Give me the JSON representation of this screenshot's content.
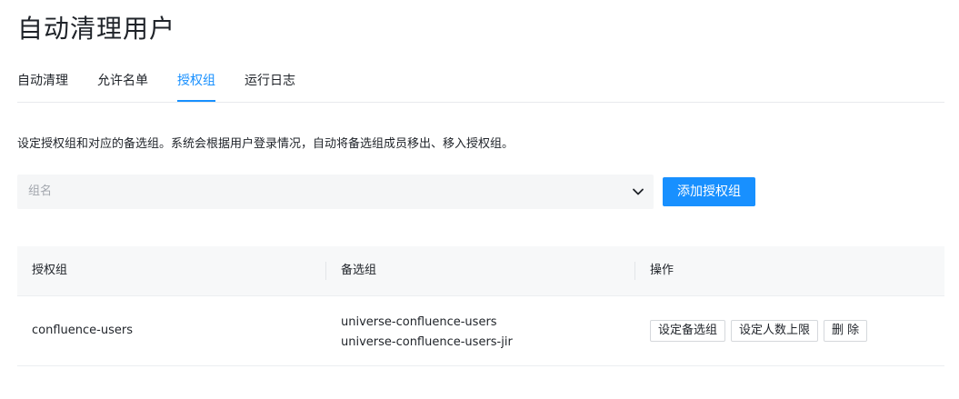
{
  "page": {
    "title": "自动清理用户"
  },
  "tabs": [
    {
      "label": "自动清理",
      "active": false
    },
    {
      "label": "允许名单",
      "active": false
    },
    {
      "label": "授权组",
      "active": true
    },
    {
      "label": "运行日志",
      "active": false
    }
  ],
  "description": "设定授权组和对应的备选组。系统会根据用户登录情况，自动将备选组成员移出、移入授权组。",
  "group_select": {
    "placeholder": "组名",
    "icon": "chevron-down-icon"
  },
  "add_button": {
    "label": "添加授权组"
  },
  "table": {
    "headers": [
      "授权组",
      "备选组",
      "操作"
    ],
    "rows": [
      {
        "group": "confluence-users",
        "backups": [
          "universe-confluence-users",
          "universe-confluence-users-jir"
        ],
        "actions": [
          "设定备选组",
          "设定人数上限",
          "删 除"
        ]
      }
    ]
  },
  "colors": {
    "accent": "#1890ff",
    "header_bg": "#f7f8f9",
    "select_bg": "#f5f6f7"
  }
}
